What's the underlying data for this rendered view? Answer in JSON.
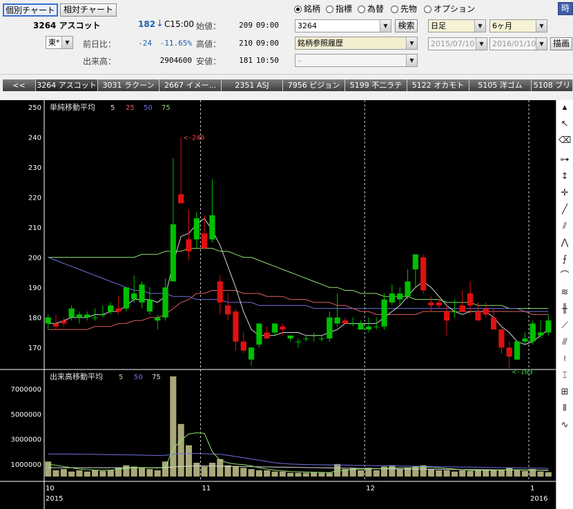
{
  "header": {
    "btn_individual": "個別チャート",
    "btn_relative": "相対チャート",
    "code_name": "3264 アスコット",
    "price": "182",
    "price_arrow": "↓",
    "price_time": "C15:00",
    "exchange": "東*",
    "label_prev_diff": "前日比：",
    "prev_diff": "-24",
    "prev_diff_pct": "-11.65%",
    "label_volume": "出来高：",
    "volume": "2904600",
    "label_open": "始値：",
    "open_val": "209",
    "open_time": "09:00",
    "label_high": "高値：",
    "high_val": "210",
    "high_time": "09:00",
    "label_low": "安値：",
    "low_val": "181",
    "low_time": "10:50"
  },
  "radios": [
    {
      "label": "銘柄",
      "checked": true
    },
    {
      "label": "指標",
      "checked": false
    },
    {
      "label": "為替",
      "checked": false
    },
    {
      "label": "先物",
      "checked": false
    },
    {
      "label": "オプション",
      "checked": false
    }
  ],
  "corner_btn": "時",
  "search": {
    "code_value": "3264",
    "search_button": "検索",
    "history": "銘柄参照履歴",
    "blank": "–"
  },
  "period": {
    "interval": "日足",
    "span": "6ヶ月",
    "from": "2015/07/10",
    "to": "2016/01/10",
    "draw_button": "描画"
  },
  "tabs": [
    "<<",
    "3264 アスコット",
    "3031 ラクーン",
    "2667 イメー...",
    "2351 ASJ",
    "7956 ピジョン",
    "5199 不二ラテ",
    "5122 オカモト",
    "5105 洋ゴム",
    "5108 ブリ"
  ],
  "price_legend": {
    "title": "単純移動平均",
    "p1": "5",
    "p2": "25",
    "p3": "50",
    "p4": "75"
  },
  "volume_legend": {
    "title": "出来高移動平均",
    "p1": "5",
    "p2": "50",
    "p3": "75"
  },
  "annotations": {
    "high": "<-240",
    "low": "<-163"
  },
  "axis": {
    "price_ticks": [
      "250",
      "240",
      "230",
      "220",
      "210",
      "200",
      "190",
      "180",
      "170"
    ],
    "volume_ticks": [
      "7000000",
      "5000000",
      "3000000",
      "1000000"
    ],
    "months": [
      "10",
      "11",
      "12",
      "1"
    ],
    "years": [
      "2015",
      "2016"
    ]
  },
  "colors": {
    "up": "#00c000",
    "down": "#e01010",
    "ma5": "#d8d8d8",
    "ma25": "#e06060",
    "ma50": "#7070e0",
    "ma75": "#90e070",
    "volume": "#a8a878",
    "grid": "#ffffff"
  },
  "chart_data": {
    "type": "candlestick",
    "price_ylim": [
      165,
      250
    ],
    "volume_ylim": [
      0,
      8000000
    ],
    "candles": [
      {
        "o": 178,
        "h": 181,
        "l": 176,
        "c": 180
      },
      {
        "o": 178,
        "h": 181,
        "l": 176,
        "c": 177
      },
      {
        "o": 179,
        "h": 180,
        "l": 177,
        "c": 178
      },
      {
        "o": 180,
        "h": 184,
        "l": 179,
        "c": 183
      },
      {
        "o": 180,
        "h": 182,
        "l": 178,
        "c": 181
      },
      {
        "o": 180,
        "h": 182,
        "l": 179,
        "c": 181
      },
      {
        "o": 180,
        "h": 183,
        "l": 179,
        "c": 180
      },
      {
        "o": 181,
        "h": 184,
        "l": 180,
        "c": 181
      },
      {
        "o": 182,
        "h": 185,
        "l": 181,
        "c": 184
      },
      {
        "o": 183,
        "h": 187,
        "l": 181,
        "c": 182
      },
      {
        "o": 183,
        "h": 190,
        "l": 182,
        "c": 190
      },
      {
        "o": 186,
        "h": 194,
        "l": 185,
        "c": 188
      },
      {
        "o": 185,
        "h": 192,
        "l": 183,
        "c": 191
      },
      {
        "o": 182,
        "h": 190,
        "l": 181,
        "c": 186
      },
      {
        "o": 179,
        "h": 181,
        "l": 176,
        "c": 180
      },
      {
        "o": 180,
        "h": 193,
        "l": 179,
        "c": 190
      },
      {
        "o": 192,
        "h": 233,
        "l": 192,
        "c": 211
      },
      {
        "o": 221,
        "h": 240,
        "l": 219,
        "c": 218
      },
      {
        "o": 206,
        "h": 216,
        "l": 199,
        "c": 202
      },
      {
        "o": 206,
        "h": 215,
        "l": 203,
        "c": 213
      },
      {
        "o": 208,
        "h": 214,
        "l": 203,
        "c": 203
      },
      {
        "o": 206,
        "h": 226,
        "l": 205,
        "c": 214
      },
      {
        "o": 192,
        "h": 194,
        "l": 181,
        "c": 185
      },
      {
        "o": 184,
        "h": 188,
        "l": 179,
        "c": 181
      },
      {
        "o": 182,
        "h": 183,
        "l": 169,
        "c": 172
      },
      {
        "o": 172,
        "h": 175,
        "l": 168,
        "c": 169
      },
      {
        "o": 166,
        "h": 170,
        "l": 164,
        "c": 170
      },
      {
        "o": 171,
        "h": 178,
        "l": 170,
        "c": 178
      },
      {
        "o": 175,
        "h": 177,
        "l": 173,
        "c": 173
      },
      {
        "o": 175,
        "h": 178,
        "l": 174,
        "c": 178
      },
      {
        "o": 177,
        "h": 178,
        "l": 174,
        "c": 176
      },
      {
        "o": 173,
        "h": 174,
        "l": 172,
        "c": 174
      },
      {
        "o": 172,
        "h": 173,
        "l": 170,
        "c": 172
      },
      {
        "o": 173,
        "h": 174,
        "l": 172,
        "c": 173
      },
      {
        "o": 174,
        "h": 175,
        "l": 172,
        "c": 174
      },
      {
        "o": 173,
        "h": 174,
        "l": 172,
        "c": 173
      },
      {
        "o": 173,
        "h": 182,
        "l": 172,
        "c": 180
      },
      {
        "o": 178,
        "h": 188,
        "l": 177,
        "c": 180
      },
      {
        "o": 179,
        "h": 180,
        "l": 178,
        "c": 178
      },
      {
        "o": 178,
        "h": 180,
        "l": 177,
        "c": 178
      },
      {
        "o": 176,
        "h": 179,
        "l": 176,
        "c": 178
      },
      {
        "o": 176,
        "h": 180,
        "l": 175,
        "c": 177
      },
      {
        "o": 177,
        "h": 180,
        "l": 176,
        "c": 177
      },
      {
        "o": 177,
        "h": 188,
        "l": 176,
        "c": 186
      },
      {
        "o": 185,
        "h": 191,
        "l": 184,
        "c": 188
      },
      {
        "o": 186,
        "h": 190,
        "l": 184,
        "c": 188
      },
      {
        "o": 187,
        "h": 196,
        "l": 186,
        "c": 192
      },
      {
        "o": 196,
        "h": 201,
        "l": 190,
        "c": 201
      },
      {
        "o": 200,
        "h": 201,
        "l": 188,
        "c": 189
      },
      {
        "o": 185,
        "h": 187,
        "l": 182,
        "c": 184
      },
      {
        "o": 185,
        "h": 186,
        "l": 183,
        "c": 184
      },
      {
        "o": 182,
        "h": 184,
        "l": 174,
        "c": 179
      },
      {
        "o": 182,
        "h": 186,
        "l": 180,
        "c": 182
      },
      {
        "o": 184,
        "h": 189,
        "l": 182,
        "c": 182
      },
      {
        "o": 188,
        "h": 192,
        "l": 181,
        "c": 184
      },
      {
        "o": 182,
        "h": 185,
        "l": 179,
        "c": 179
      },
      {
        "o": 183,
        "h": 185,
        "l": 180,
        "c": 181
      },
      {
        "o": 180,
        "h": 183,
        "l": 176,
        "c": 176
      },
      {
        "o": 176,
        "h": 178,
        "l": 168,
        "c": 170
      },
      {
        "o": 170,
        "h": 172,
        "l": 163,
        "c": 167
      },
      {
        "o": 166,
        "h": 172,
        "l": 166,
        "c": 172
      },
      {
        "o": 172,
        "h": 175,
        "l": 171,
        "c": 173
      },
      {
        "o": 172,
        "h": 179,
        "l": 171,
        "c": 178
      },
      {
        "o": 174,
        "h": 179,
        "l": 173,
        "c": 175
      },
      {
        "o": 175,
        "h": 181,
        "l": 174,
        "c": 179
      }
    ],
    "volumes": [
      1200000,
      500000,
      600000,
      400000,
      500000,
      400000,
      500000,
      450000,
      500000,
      700000,
      900000,
      800000,
      700000,
      600000,
      500000,
      1200000,
      8800000,
      4200000,
      2500000,
      1100000,
      800000,
      1100000,
      1400000,
      900000,
      800000,
      700000,
      600000,
      500000,
      500000,
      400000,
      400000,
      300000,
      300000,
      300000,
      350000,
      300000,
      300000,
      1000000,
      600000,
      700000,
      500000,
      700000,
      500000,
      800000,
      900000,
      600000,
      700000,
      800000,
      900000,
      600000,
      500000,
      500000,
      400000,
      500000,
      450000,
      500000,
      550000,
      500000,
      500000,
      700000,
      500000,
      450000,
      600000,
      400000,
      350000
    ],
    "ma5": [
      178,
      178,
      179,
      180,
      180,
      180,
      181,
      181,
      182,
      182,
      184,
      186,
      186,
      186,
      185,
      187,
      198,
      207,
      208,
      211,
      213,
      209,
      204,
      197,
      190,
      182,
      176,
      174,
      174,
      174,
      175,
      175,
      175,
      174,
      174,
      174,
      175,
      176,
      178,
      178,
      178,
      178,
      178,
      180,
      182,
      184,
      187,
      190,
      192,
      190,
      187,
      184,
      182,
      181,
      182,
      182,
      182,
      180,
      177,
      175,
      172,
      171,
      172,
      174,
      176
    ],
    "ma25": [
      176,
      176,
      176,
      176,
      176,
      176,
      177,
      177,
      177,
      178,
      178,
      179,
      179,
      180,
      180,
      181,
      183,
      185,
      186,
      188,
      188,
      189,
      189,
      189,
      189,
      188,
      188,
      188,
      187,
      187,
      187,
      186,
      186,
      186,
      185,
      185,
      185,
      184,
      184,
      183,
      182,
      182,
      181,
      181,
      181,
      181,
      181,
      181,
      182,
      182,
      182,
      182,
      182,
      182,
      182,
      182,
      182,
      182,
      182,
      182,
      182,
      182,
      181,
      181,
      181
    ],
    "ma50": [
      200,
      199,
      198,
      197,
      196,
      195,
      194,
      193,
      192,
      191,
      190,
      189,
      189,
      188,
      188,
      188,
      187,
      187,
      187,
      186,
      186,
      186,
      186,
      185,
      185,
      185,
      185,
      184,
      184,
      184,
      184,
      184,
      184,
      184,
      183,
      183,
      183,
      183,
      183,
      183,
      183,
      183,
      183,
      183,
      183,
      183,
      183,
      183,
      183,
      183,
      183,
      183,
      183,
      183,
      183,
      183,
      183,
      183,
      183,
      183,
      183,
      182,
      182,
      182,
      182
    ],
    "ma75": [
      200,
      200,
      200,
      200,
      200,
      200,
      200,
      200,
      200,
      200,
      200,
      200,
      201,
      201,
      201,
      202,
      202,
      202,
      203,
      203,
      203,
      203,
      202,
      202,
      201,
      200,
      200,
      199,
      198,
      197,
      196,
      195,
      194,
      193,
      192,
      191,
      190,
      190,
      189,
      189,
      188,
      188,
      188,
      187,
      187,
      187,
      187,
      186,
      186,
      186,
      186,
      185,
      185,
      185,
      185,
      184,
      184,
      184,
      184,
      183,
      183,
      183,
      183,
      183,
      183
    ],
    "vma5": [
      1000000,
      900000,
      800000,
      700000,
      600000,
      550000,
      520000,
      500000,
      520000,
      560000,
      650000,
      700000,
      720000,
      700000,
      680000,
      750000,
      2200000,
      2900000,
      3400000,
      3500000,
      3450000,
      2000000,
      1300000,
      1100000,
      1000000,
      950000,
      850000,
      700000,
      600000,
      500000,
      450000,
      400000,
      380000,
      360000,
      340000,
      330000,
      320000,
      450000,
      500000,
      560000,
      600000,
      620000,
      620000,
      640000,
      680000,
      700000,
      700000,
      720000,
      750000,
      720000,
      700000,
      650000,
      600000,
      550000,
      500000,
      500000,
      500000,
      500000,
      520000,
      540000,
      540000,
      530000,
      520000,
      500000,
      480000
    ],
    "vma50": [
      1800000,
      1800000,
      1800000,
      1800000,
      1790000,
      1780000,
      1770000,
      1760000,
      1750000,
      1740000,
      1730000,
      1720000,
      1710000,
      1700000,
      1690000,
      1700000,
      1780000,
      1820000,
      1850000,
      1840000,
      1820000,
      1800000,
      1780000,
      1700000,
      1600000,
      1500000,
      1400000,
      1300000,
      1200000,
      1100000,
      1050000,
      1000000,
      980000,
      960000,
      950000,
      940000,
      930000,
      920000,
      910000,
      900000,
      890000,
      880000,
      870000,
      860000,
      850000,
      840000,
      830000,
      820000,
      810000,
      800000,
      790000,
      780000,
      770000,
      760000,
      750000,
      740000,
      730000,
      720000,
      710000,
      700000,
      690000,
      680000,
      670000,
      660000,
      650000
    ],
    "vma75": [
      700000,
      700000,
      700000,
      700000,
      700000,
      700000,
      700000,
      700000,
      700000,
      700000,
      700000,
      700000,
      700000,
      700000,
      700000,
      700000,
      780000,
      800000,
      830000,
      840000,
      840000,
      840000,
      830000,
      820000,
      810000,
      800000,
      790000,
      780000,
      770000,
      760000,
      750000,
      740000,
      730000,
      720000,
      710000,
      700000,
      690000,
      680000,
      670000,
      660000,
      650000,
      640000,
      630000,
      620000,
      610000,
      600000,
      600000,
      590000,
      590000,
      580000,
      580000,
      570000,
      570000,
      560000,
      560000,
      550000,
      550000,
      540000,
      540000,
      530000,
      530000,
      520000,
      520000,
      510000,
      510000
    ]
  }
}
